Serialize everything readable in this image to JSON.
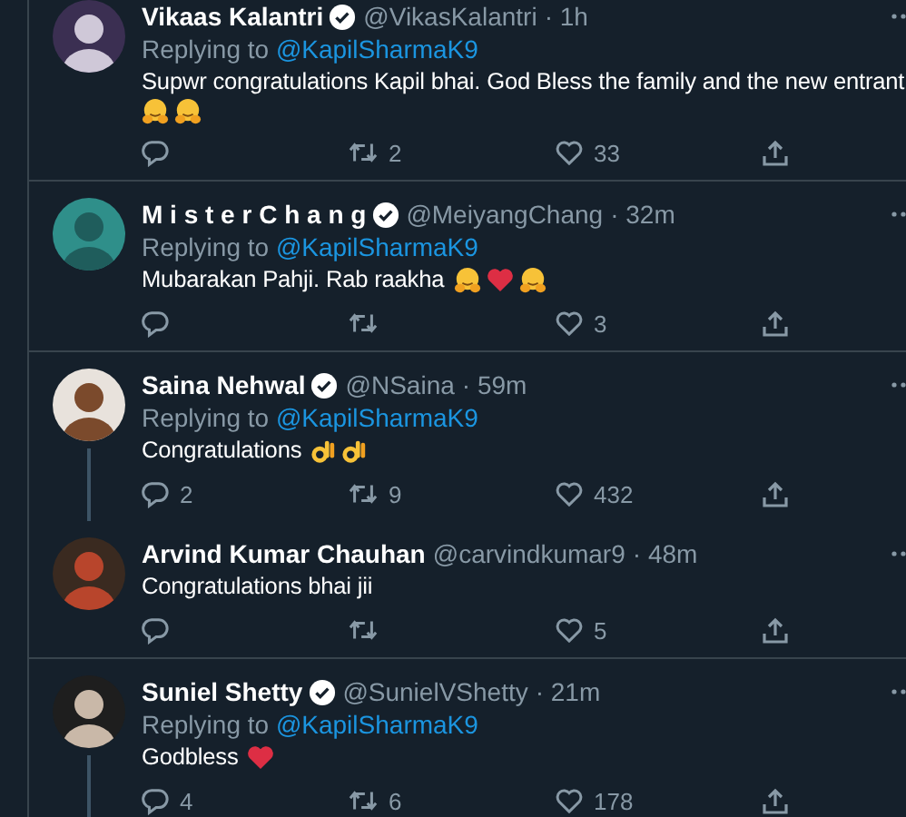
{
  "tweets": [
    {
      "name": "Vikaas Kalantri",
      "verified": true,
      "handle": "@VikasKalantri",
      "time": "· 1h",
      "replying_prefix": "Replying to",
      "replying_to": "@KapilSharmaK9",
      "text": "Supwr congratulations Kapil bhai. God Bless the family and the new entrant",
      "emojis": [
        {
          "kind": "hug"
        },
        {
          "kind": "hug"
        }
      ],
      "emoji_line": true,
      "threaded": false,
      "retweets": "2",
      "likes": "33"
    },
    {
      "name": "M i s t e r   C h a n g",
      "verified": true,
      "handle": "@MeiyangChang",
      "time": "· 32m",
      "replying_prefix": "Replying to",
      "replying_to": "@KapilSharmaK9",
      "text": "Mubarakan Pahji. Rab raakha",
      "emojis": [
        {
          "kind": "hug"
        },
        {
          "kind": "heart"
        },
        {
          "kind": "hug"
        }
      ],
      "emoji_line": false,
      "threaded": false,
      "likes": "3"
    },
    {
      "name": "Saina Nehwal",
      "verified": true,
      "handle": "@NSaina",
      "time": "· 59m",
      "replying_prefix": "Replying to",
      "replying_to": "@KapilSharmaK9",
      "text": "Congratulations",
      "emojis": [
        {
          "kind": "ok"
        },
        {
          "kind": "ok"
        }
      ],
      "emoji_line": false,
      "threaded": true,
      "replies": "2",
      "retweets": "9",
      "likes": "432"
    },
    {
      "name": "Arvind Kumar Chauhan",
      "verified": false,
      "handle": "@carvindkumar9",
      "time": "· 48m",
      "text": "Congratulations bhai jii",
      "threaded": false,
      "likes": "5"
    },
    {
      "name": "Suniel Shetty",
      "verified": true,
      "handle": "@SunielVShetty",
      "time": "· 21m",
      "replying_prefix": "Replying to",
      "replying_to": "@KapilSharmaK9",
      "text": "Godbless",
      "emojis": [
        {
          "kind": "heart"
        }
      ],
      "emoji_line": false,
      "threaded": true,
      "replies": "4",
      "retweets": "6",
      "likes": "178"
    }
  ]
}
